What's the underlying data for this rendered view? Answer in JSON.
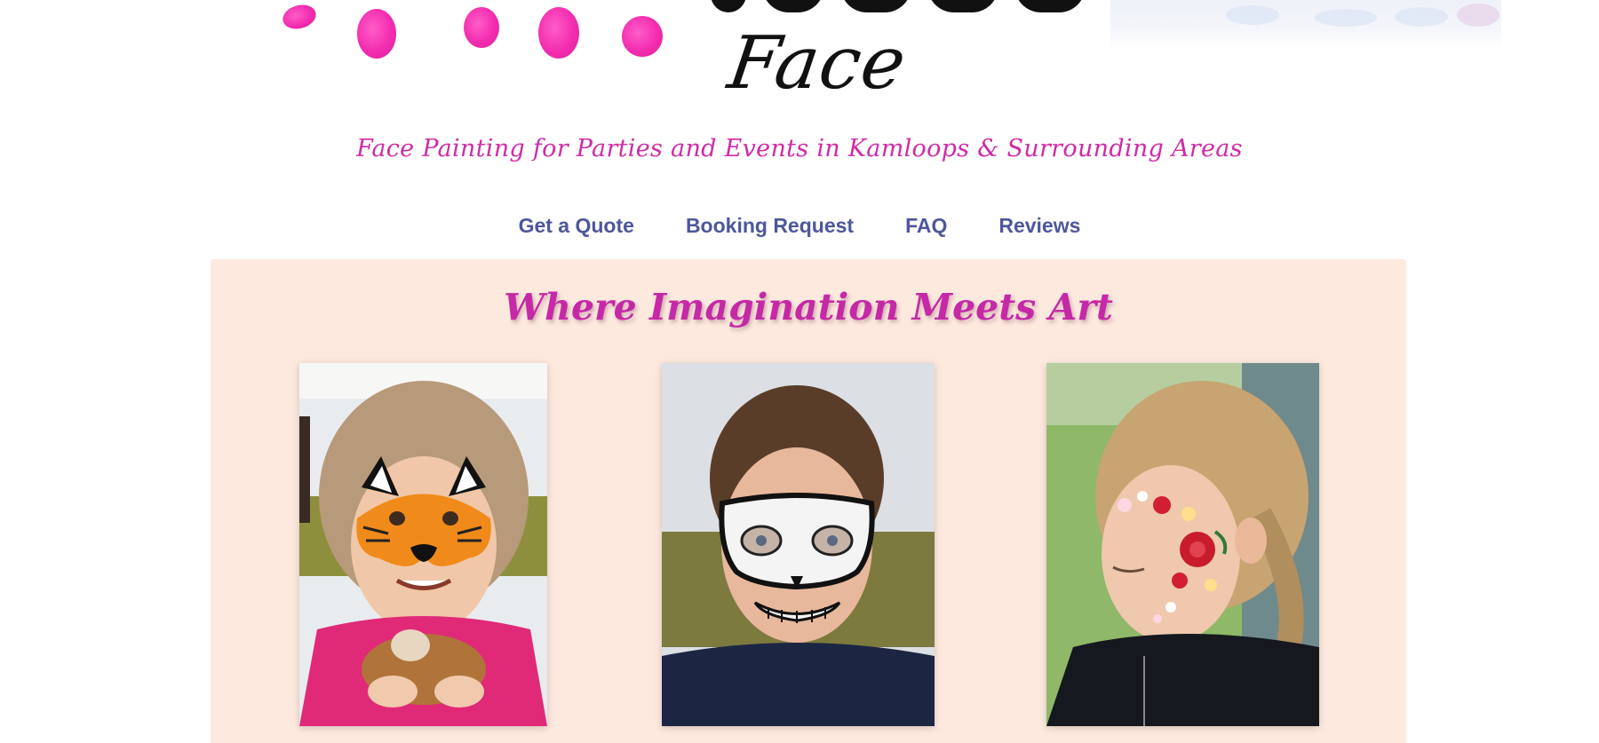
{
  "header": {
    "logo_text": "Face painting",
    "tagline": "Face Painting for Parties and Events in Kamloops & Surrounding Areas"
  },
  "nav": {
    "items": [
      {
        "label": "Get a Quote"
      },
      {
        "label": "Booking Request"
      },
      {
        "label": "FAQ"
      },
      {
        "label": "Reviews"
      }
    ]
  },
  "gallery": {
    "title": "Where Imagination Meets Art",
    "photos": [
      {
        "subject": "girl-tiger-face-paint"
      },
      {
        "subject": "boy-skull-mask-face-paint"
      },
      {
        "subject": "girl-flower-cheek-face-paint"
      }
    ]
  },
  "colors": {
    "brand_pink": "#d12aa6",
    "nav_blue": "#4e579b",
    "section_bg": "#fde9de",
    "petal_pink": "#f21aa8"
  }
}
